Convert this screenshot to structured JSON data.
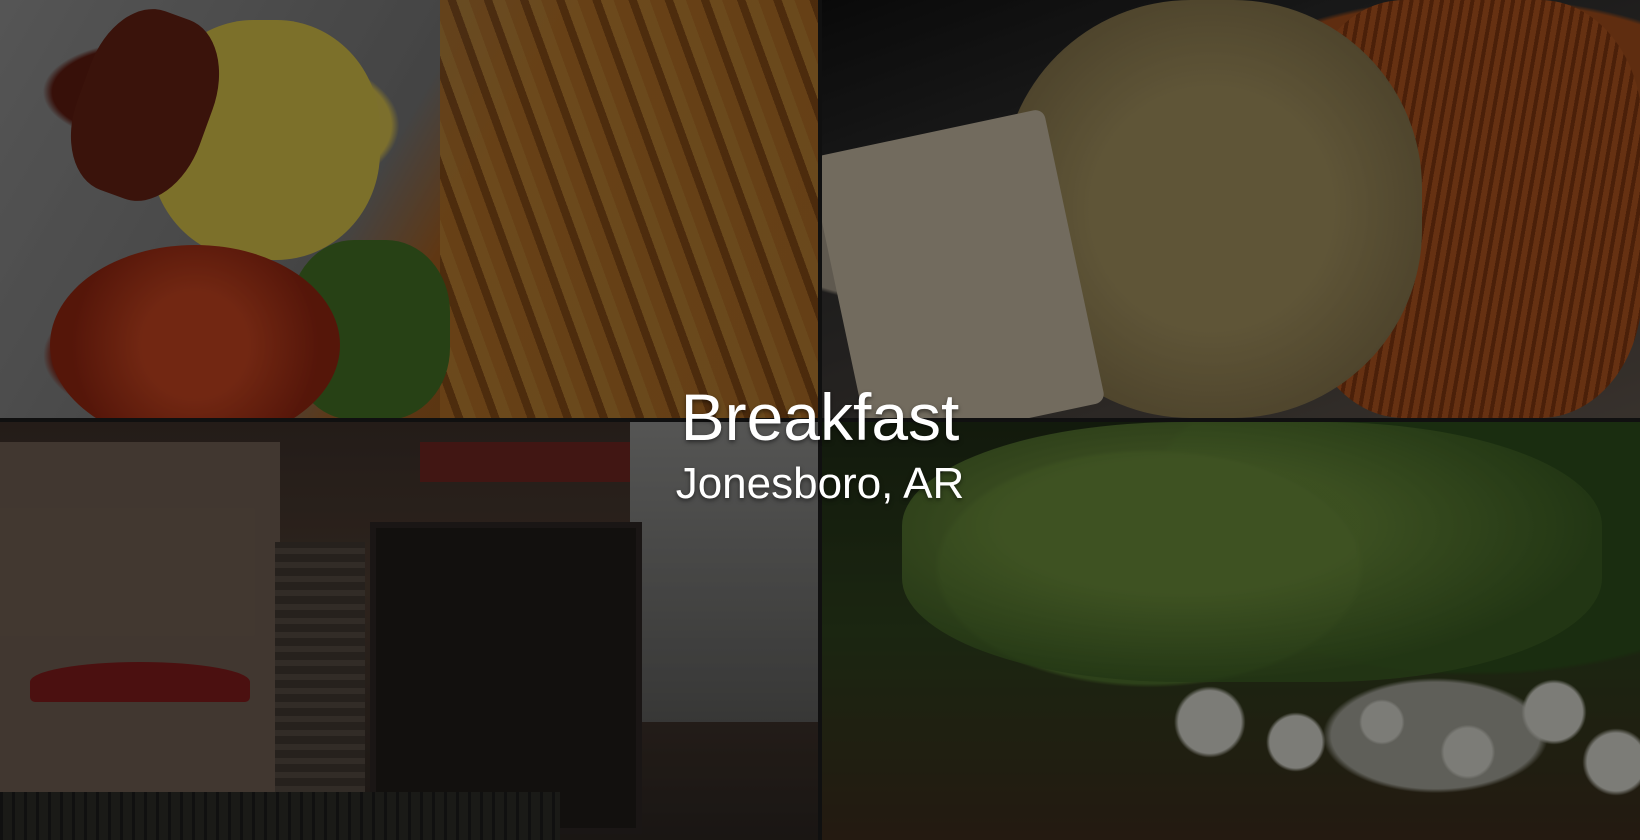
{
  "hero": {
    "title": "Breakfast",
    "subtitle": "Jonesboro, AR"
  },
  "photos": [
    {
      "icon": "burger-fries-photo"
    },
    {
      "icon": "omelet-hashbrowns-photo"
    },
    {
      "icon": "restaurant-storefront-photo"
    },
    {
      "icon": "turnips-greens-photo"
    }
  ],
  "colors": {
    "overlay": "#000000",
    "text": "#ffffff"
  }
}
